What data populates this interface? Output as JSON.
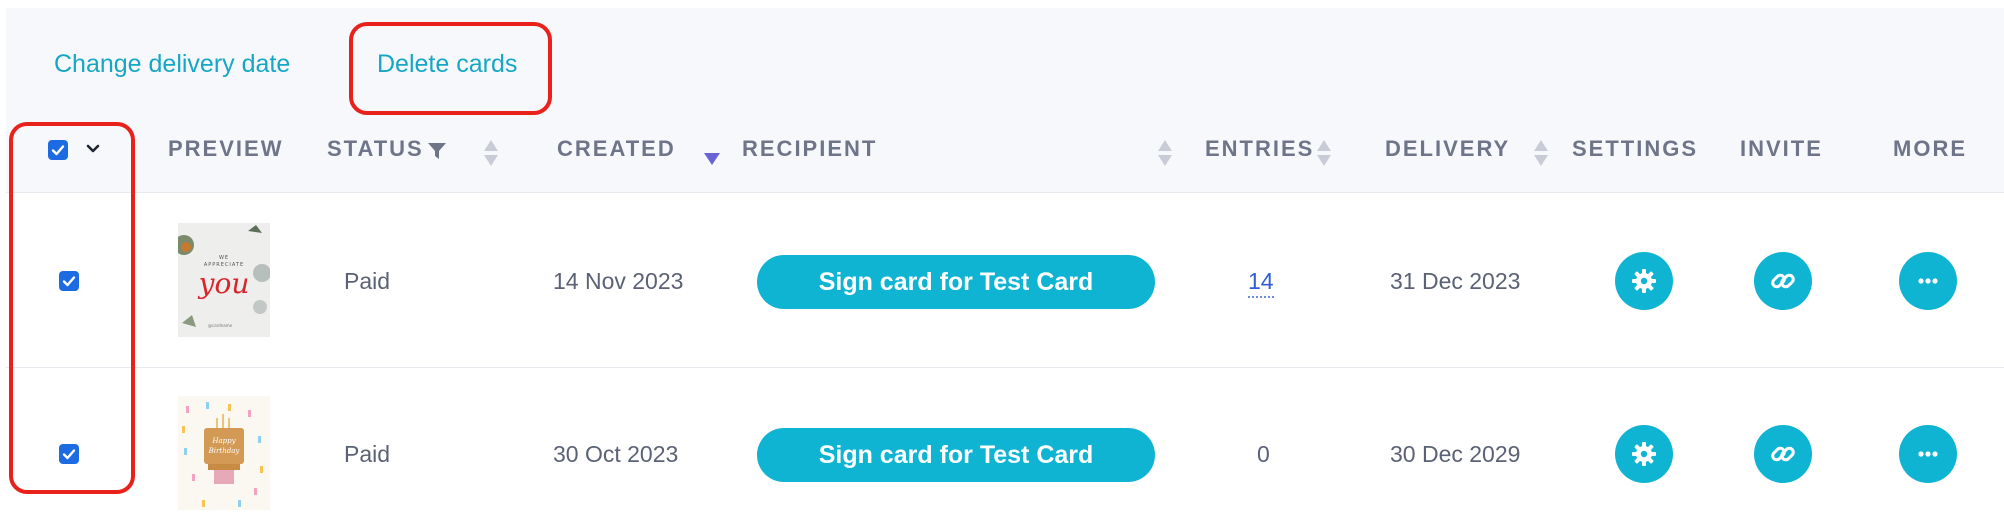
{
  "bulk_actions": {
    "change_delivery_label": "Change delivery date",
    "delete_label": "Delete cards"
  },
  "table": {
    "columns": {
      "preview": "PREVIEW",
      "status": "STATUS",
      "created": "CREATED",
      "recipient": "RECIPIENT",
      "entries": "ENTRIES",
      "delivery": "DELIVERY",
      "settings": "SETTINGS",
      "invite": "INVITE",
      "more": "MORE"
    },
    "rows": [
      {
        "selected": true,
        "preview_text": "WE APPRECIATE you",
        "status": "Paid",
        "created": "14 Nov 2023",
        "recipient_button": "Sign card for Test Card",
        "entries": "14",
        "delivery": "31 Dec 2023"
      },
      {
        "selected": true,
        "preview_text": "Happy Birthday",
        "status": "Paid",
        "created": "30 Oct 2023",
        "recipient_button": "Sign card for Test Card",
        "entries": "0",
        "delivery": "30 Dec 2029"
      }
    ]
  },
  "colors": {
    "accent": "#0fb4d3",
    "link": "#16a7c4",
    "checkbox": "#1d6be3",
    "highlight": "#e8221b"
  }
}
